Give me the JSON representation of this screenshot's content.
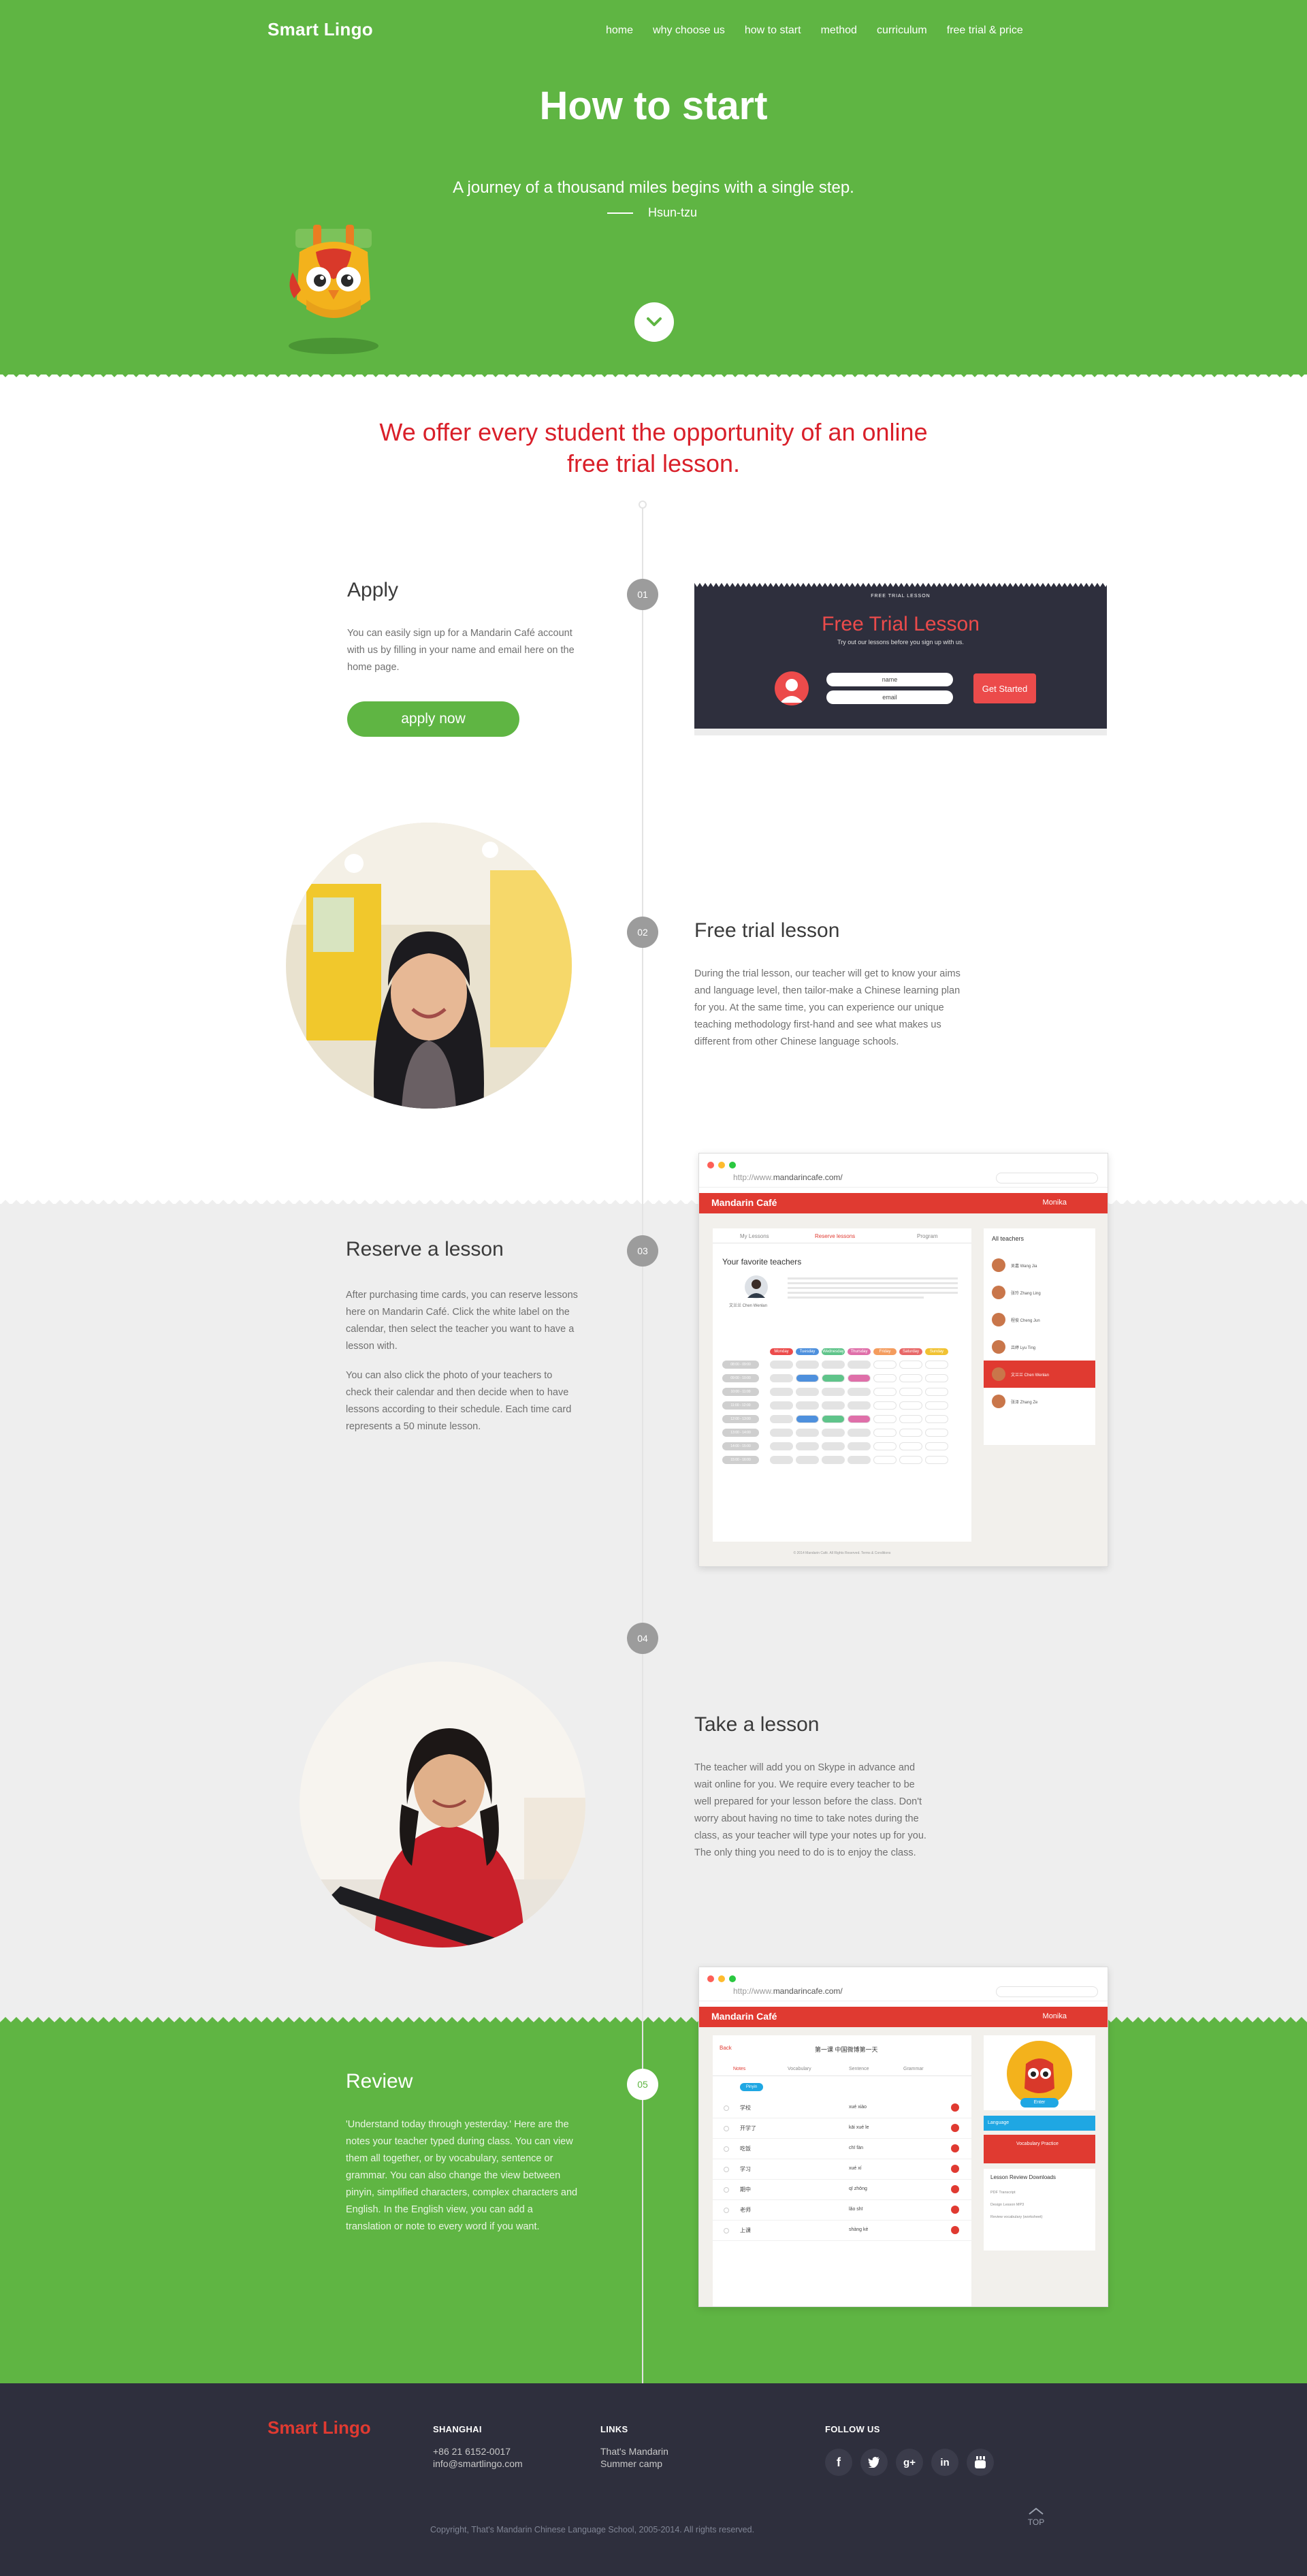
{
  "header": {
    "brand": "Smart Lingo",
    "nav": [
      "home",
      "why choose us",
      "how to start",
      "method",
      "curriculum",
      "free trial & price"
    ]
  },
  "hero": {
    "title": "How to start",
    "quote": "A journey of a thousand miles begins with a single step.",
    "author": "Hsun-tzu"
  },
  "offer": {
    "line1": "We offer every student the opportunity of an online",
    "line2": "free trial lesson."
  },
  "steps": [
    {
      "num": "01",
      "title": "Apply",
      "text": "You can easily  sign up for a Mandarin Café account with us by filling in your name and email here on the home page.",
      "button": "apply now"
    },
    {
      "num": "02",
      "title": "Free trial lesson",
      "text": "During the trial lesson, our teacher will get to know your aims and language level, then tailor-make a Chinese learning plan for you. At the same time, you can experience our unique teaching methodology first-hand and see what makes us different from other Chinese language schools."
    },
    {
      "num": "03",
      "title": "Reserve a lesson",
      "text1": "After purchasing time cards, you can reserve lessons here on Mandarin Café. Click the white label on the calendar, then select the teacher you want to have a lesson with.",
      "text2": "You can also click the photo of your teachers to check their calendar and then decide when to have lessons according to their schedule. Each time card represents a 50 minute lesson."
    },
    {
      "num": "04",
      "title": "Take a lesson",
      "text": "The teacher will add you on Skype in advance and wait online for you. We require every teacher to be well prepared for your lesson before the class. Don't worry about having no time to take notes during the class, as your teacher will type your notes up for you. The only thing you need to do is to enjoy the class."
    },
    {
      "num": "05",
      "title": "Review",
      "text": "'Understand today through yesterday.' Here are the notes your teacher typed during class. You can view them all together, or by vocabulary, sentence or grammar. You can also change the view between pinyin, simplified characters, complex characters and English. In the English view, you can add a translation or note to every word if you want."
    }
  ],
  "trial_card": {
    "small": "FREE TRIAL LESSON",
    "title": "Free Trial Lesson",
    "subtitle": "Try out our lessons before you sign up with us.",
    "name_placeholder": "name",
    "email_placeholder": "email",
    "button": "Get Started"
  },
  "browser": {
    "url_prefix": "http://www.",
    "url_domain": "mandarincafe.com/",
    "logo": "Mandarin Café",
    "user": "Monika",
    "reserve": {
      "tabs": [
        "My Lessons",
        "Reserve lessons",
        "Program"
      ],
      "fav_title": "Your favorite teachers",
      "teacher_name": "文兰兰 Chen Wenlan",
      "all_teachers": "All teachers",
      "teachers": [
        "吴嘉 Wang Jia",
        "张玲 Zhang Ling",
        "程俊 Cheng Jun",
        "吕婷 Lyu Ting",
        "文兰兰 Chen Wenlan",
        "张泽 Zhang Ze"
      ],
      "days": [
        "Monday",
        "Tuesday",
        "Wednesday",
        "Thursday",
        "Friday",
        "Saturday",
        "Sunday"
      ],
      "times": [
        "08:00 - 09:00",
        "09:00 - 10:00",
        "10:00 - 11:00",
        "11:00 - 12:00",
        "12:00 - 13:00",
        "13:00 - 14:00",
        "14:00 - 15:00",
        "15:00 - 16:00"
      ],
      "footer": "© 2014 Mandarin Café. All Rights Reserved. Terms & Conditions"
    },
    "review": {
      "back": "Back",
      "lesson_title": "第一课 中国微博第一天",
      "tabs": [
        "Notes",
        "Vocabulary",
        "Sentence",
        "Grammar"
      ],
      "pill": "Pinyin",
      "rows": [
        {
          "cn": "学校",
          "py": "xué xiào"
        },
        {
          "cn": "开学了",
          "py": "kāi xué le"
        },
        {
          "cn": "吃饭",
          "py": "chī fàn"
        },
        {
          "cn": "学习",
          "py": "xué xí"
        },
        {
          "cn": "期中",
          "py": "qī zhōng"
        },
        {
          "cn": "老师",
          "py": "lǎo shī"
        },
        {
          "cn": "上课",
          "py": "shàng kè"
        }
      ],
      "enter": "Enter",
      "language": "Language",
      "practice": "Vocabulary Practice",
      "downloads": "Lesson Review Downloads",
      "dl_items": [
        "PDF Transcript",
        "Design Lesson MP3",
        "Review vocabulary (worksheet)"
      ]
    }
  },
  "footer": {
    "brand": "Smart Lingo",
    "col1_head": "SHANGHAI",
    "phone": "+86 21 6152-0017",
    "email": "info@smartlingo.com",
    "col2_head": "LINKS",
    "link1": "That's Mandarin",
    "link2": "Summer camp",
    "col3_head": "FOLLOW US",
    "social": [
      "facebook",
      "twitter",
      "google-plus",
      "linkedin",
      "youtube"
    ],
    "copyright": "Copyright, That's Mandarin Chinese Language School, 2005-2014. All rights reserved.",
    "top": "TOP"
  },
  "colors": {
    "green": "#5fb543",
    "red": "#d9202a",
    "dark": "#2e2f3d",
    "grey_band": "#eeeeee"
  }
}
